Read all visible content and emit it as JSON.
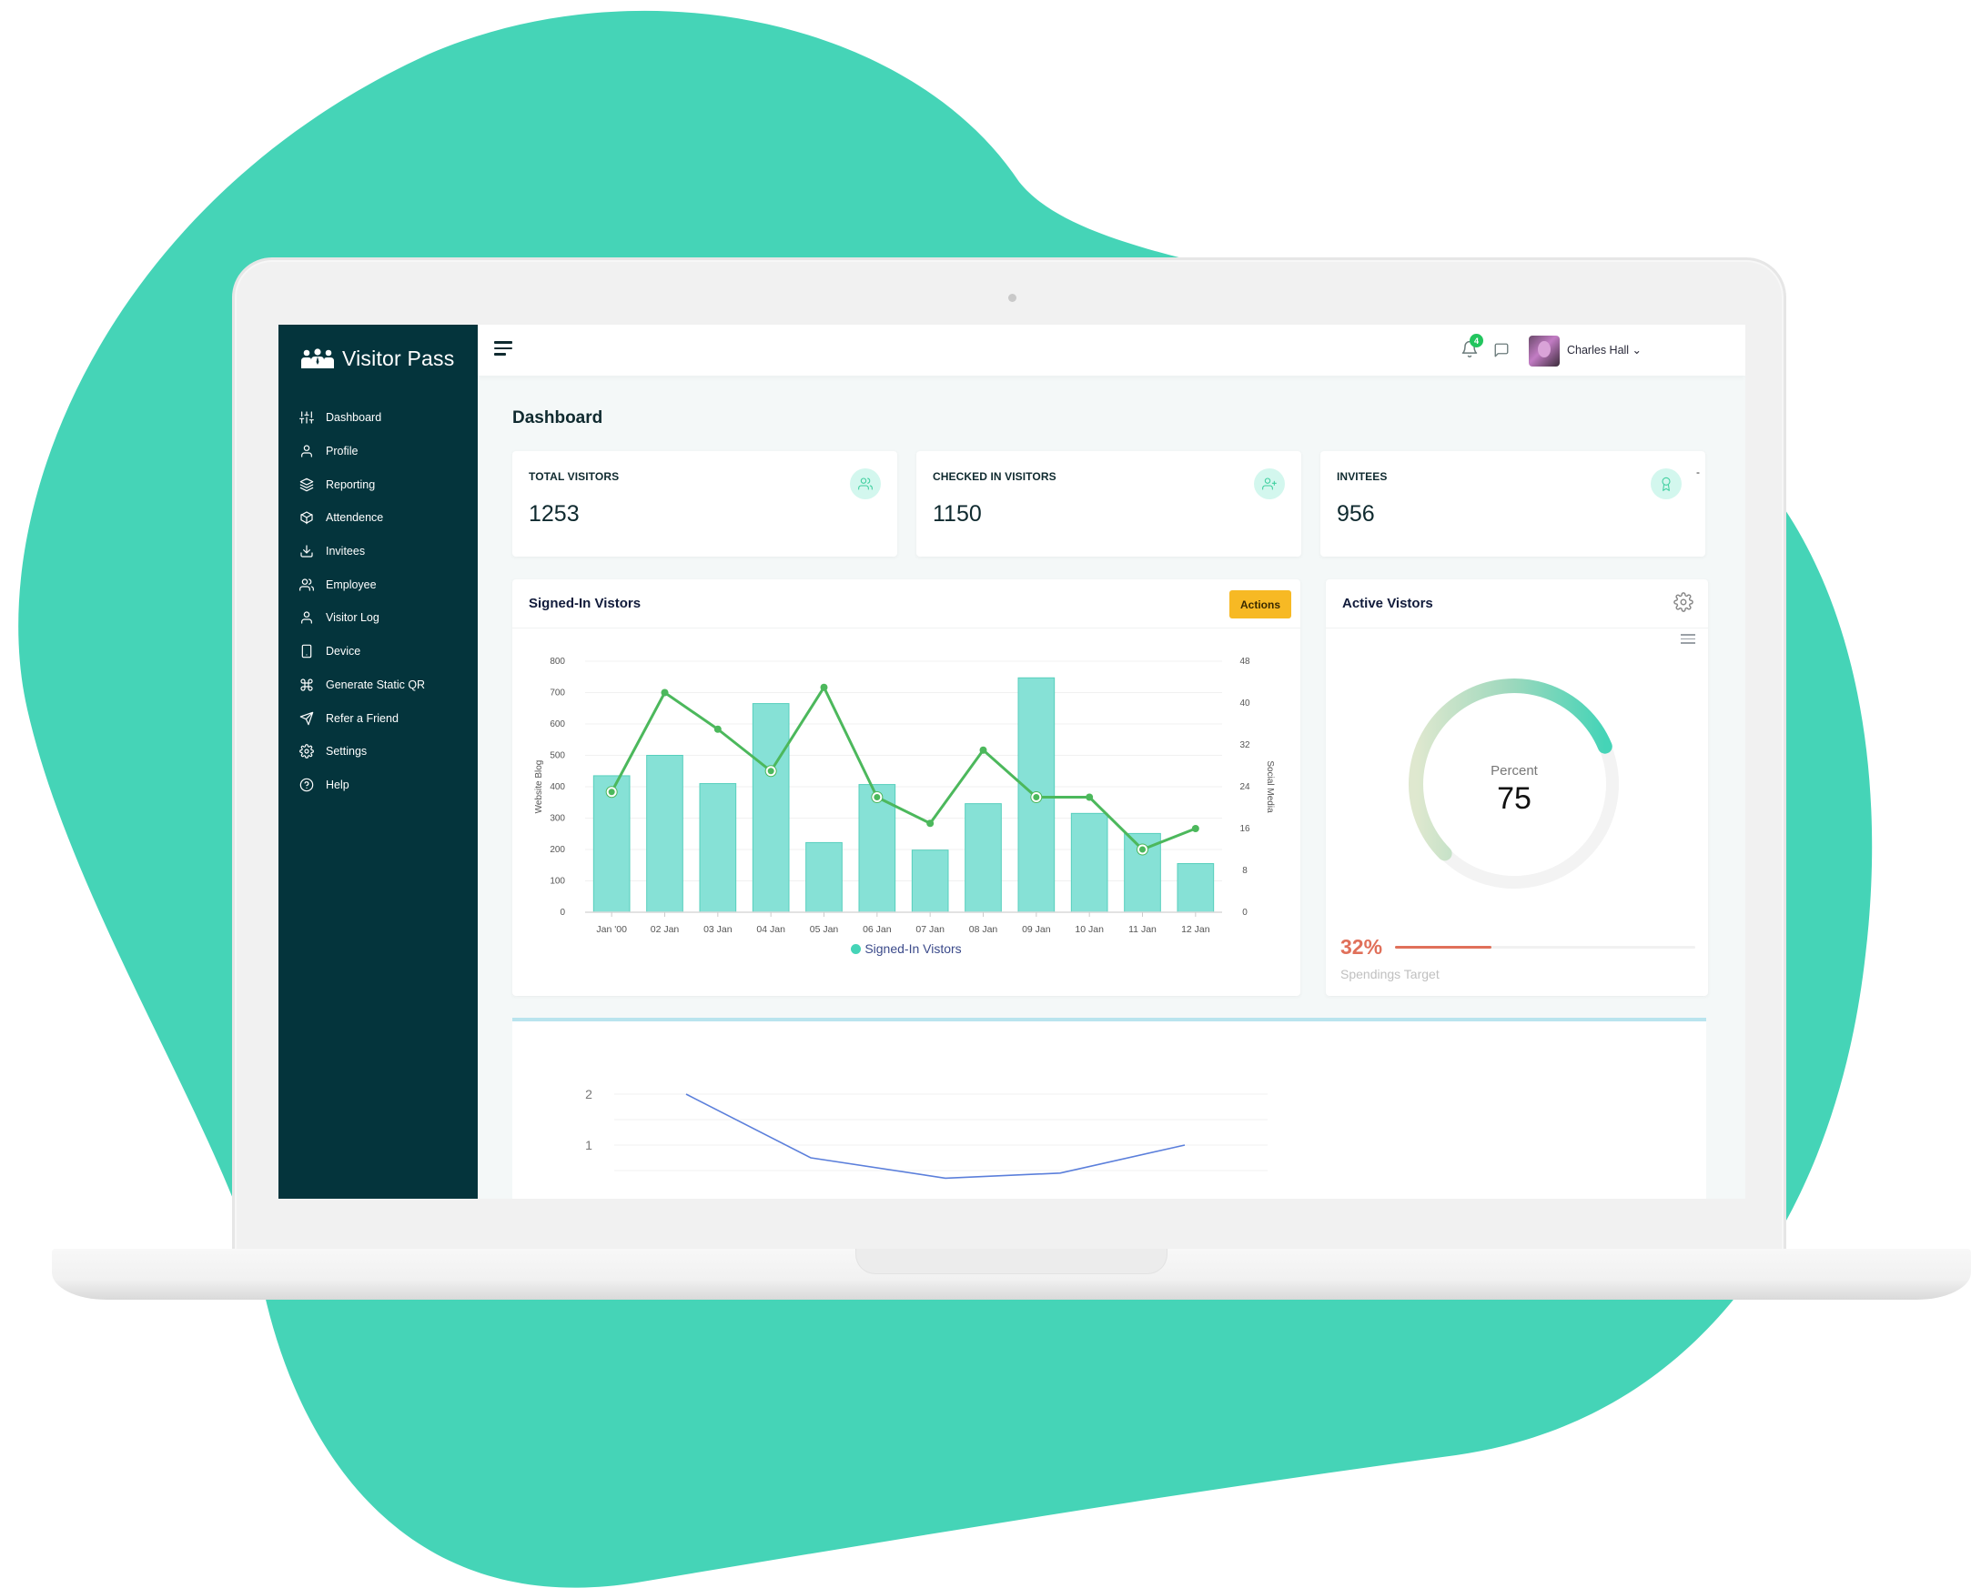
{
  "colors": {
    "blob": "#45D4B7",
    "sidebar_bg": "#04343C",
    "accent": "#45D4B7",
    "line_series": "#4CB85C",
    "actions_button": "#F7B924",
    "target_red": "#E0705A",
    "badge_green": "#22C55E",
    "bottom_line": "#5B7FDB"
  },
  "sidebar": {
    "brand": "Visitor Pass",
    "brand_icon": "users-group-icon",
    "items": [
      {
        "label": "Dashboard",
        "icon": "sliders-icon"
      },
      {
        "label": "Profile",
        "icon": "user-icon"
      },
      {
        "label": "Reporting",
        "icon": "layers-icon"
      },
      {
        "label": "Attendence",
        "icon": "box-icon"
      },
      {
        "label": "Invitees",
        "icon": "download-icon"
      },
      {
        "label": "Employee",
        "icon": "users-icon"
      },
      {
        "label": "Visitor Log",
        "icon": "user-icon"
      },
      {
        "label": "Device",
        "icon": "tablet-icon"
      },
      {
        "label": "Generate Static QR",
        "icon": "command-icon"
      },
      {
        "label": "Refer a Friend",
        "icon": "send-icon"
      },
      {
        "label": "Settings",
        "icon": "gear-icon"
      },
      {
        "label": "Help",
        "icon": "help-circle-icon"
      }
    ]
  },
  "topbar": {
    "notification_count": "4",
    "user_name": "Charles Hall ⌄"
  },
  "page": {
    "title": "Dashboard"
  },
  "stats": [
    {
      "label": "TOTAL VISITORS",
      "value": "1253",
      "icon": "users-icon"
    },
    {
      "label": "CHECKED IN VISITORS",
      "value": "1150",
      "icon": "user-plus-icon"
    },
    {
      "label": "INVITEES",
      "value": "956",
      "icon": "award-icon",
      "extra": "-"
    }
  ],
  "signed_in_card": {
    "title": "Signed-In Vistors",
    "actions_label": "Actions",
    "legend": "Signed-In Vistors"
  },
  "active_card": {
    "title": "Active Vistors",
    "gauge_label": "Percent",
    "gauge_value": "75",
    "gauge_percent": 75,
    "target_percent_label": "32%",
    "target_percent": 32,
    "target_label": "Spendings Target"
  },
  "chart_data": [
    {
      "type": "bar",
      "title": "Signed-In Vistors",
      "categories": [
        "Jan '00",
        "02 Jan",
        "03 Jan",
        "04 Jan",
        "05 Jan",
        "06 Jan",
        "07 Jan",
        "08 Jan",
        "09 Jan",
        "10 Jan",
        "11 Jan",
        "12 Jan"
      ],
      "series": [
        {
          "name": "Website Blog",
          "kind": "bar",
          "axis": "left",
          "values": [
            435,
            500,
            410,
            665,
            222,
            407,
            198,
            346,
            747,
            315,
            251,
            155
          ]
        },
        {
          "name": "Social Media",
          "kind": "line",
          "axis": "right",
          "values": [
            23,
            42,
            35,
            27,
            43,
            22,
            17,
            31,
            22,
            22,
            12,
            16
          ]
        }
      ],
      "ylabel": "Website Blog",
      "ylabel_right": "Social Media",
      "ylim": [
        0,
        800
      ],
      "yticks": [
        0,
        100,
        200,
        300,
        400,
        500,
        600,
        700,
        800
      ],
      "ylim_right": [
        0,
        48
      ],
      "yticks_right": [
        0,
        8,
        16,
        24,
        32,
        40,
        48
      ],
      "hollow_markers": [
        0,
        3,
        5,
        8,
        10
      ],
      "legend": "Signed-In Vistors",
      "legend_position": "bottom-center",
      "grid": true
    },
    {
      "type": "line",
      "title": "",
      "x_fraction": [
        0.0,
        0.25,
        0.52,
        0.75,
        1.0
      ],
      "values": [
        2,
        0.75,
        0.35,
        0.45,
        1
      ],
      "yticks": [
        1,
        2
      ],
      "ylim": [
        0.5,
        2
      ],
      "grid": true,
      "note": "partially visible, cropped at bottom of screen"
    }
  ]
}
